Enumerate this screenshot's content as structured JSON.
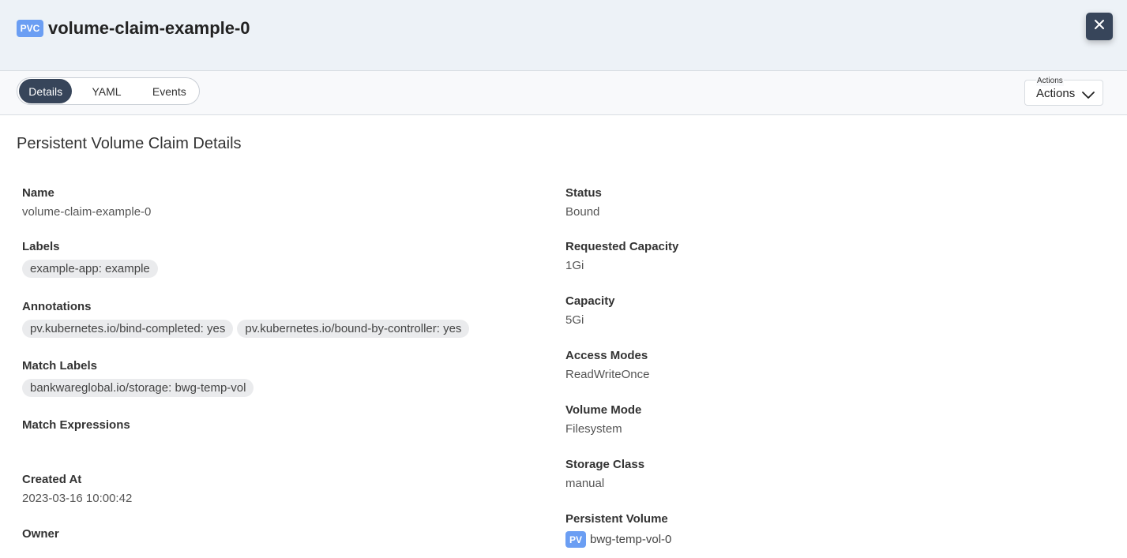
{
  "header": {
    "kind_badge": "PVC",
    "title": "volume-claim-example-0",
    "close_icon": "close-icon"
  },
  "toolbar": {
    "tabs": [
      {
        "label": "Details",
        "active": true
      },
      {
        "label": "YAML",
        "active": false
      },
      {
        "label": "Events",
        "active": false
      }
    ],
    "actions": {
      "legend": "Actions",
      "value": "Actions",
      "icon": "chevron-down-icon"
    }
  },
  "section_title": "Persistent Volume Claim Details",
  "left": {
    "name": {
      "label": "Name",
      "value": "volume-claim-example-0"
    },
    "labels": {
      "label": "Labels",
      "chips": [
        "example-app: example"
      ]
    },
    "annotations": {
      "label": "Annotations",
      "chips": [
        "pv.kubernetes.io/bind-completed: yes",
        "pv.kubernetes.io/bound-by-controller: yes"
      ]
    },
    "match_labels": {
      "label": "Match Labels",
      "chips": [
        "bankwareglobal.io/storage: bwg-temp-vol"
      ]
    },
    "match_expressions": {
      "label": "Match Expressions"
    },
    "created_at": {
      "label": "Created At",
      "value": "2023-03-16 10:00:42"
    },
    "owner": {
      "label": "Owner"
    }
  },
  "right": {
    "status": {
      "label": "Status",
      "value": "Bound"
    },
    "requested_capacity": {
      "label": "Requested Capacity",
      "value": "1Gi"
    },
    "capacity": {
      "label": "Capacity",
      "value": "5Gi"
    },
    "access_modes": {
      "label": "Access Modes",
      "value": "ReadWriteOnce"
    },
    "volume_mode": {
      "label": "Volume Mode",
      "value": "Filesystem"
    },
    "storage_class": {
      "label": "Storage Class",
      "value": "manual"
    },
    "persistent_volume": {
      "label": "Persistent Volume",
      "badge": "PV",
      "value": "bwg-temp-vol-0"
    }
  },
  "colors": {
    "badge": "#6b9ef3",
    "dark": "#37455a",
    "header_bg": "#edf2f7"
  }
}
